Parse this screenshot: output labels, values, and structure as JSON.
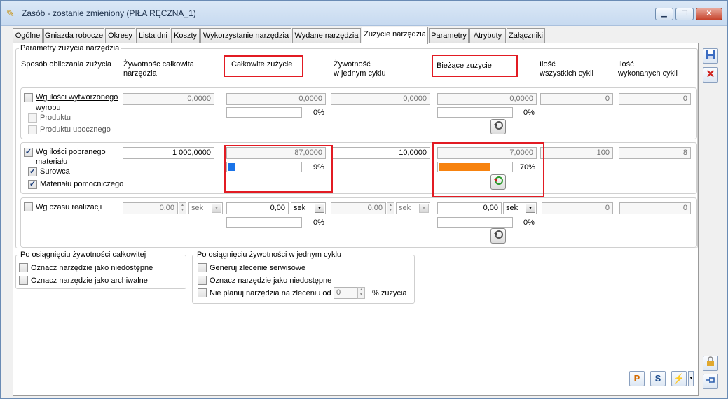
{
  "window": {
    "title": "Zasób - zostanie zmieniony  (PIŁA RĘCZNA_1)",
    "min": "▁",
    "max": "❐",
    "close": "✕"
  },
  "tabs": [
    "Ogólne",
    "Gniazda robocze",
    "Okresy",
    "Lista dni",
    "Koszty",
    "Wykorzystanie narzędzia",
    "Wydane narzędzia",
    "Zużycie narzędzia",
    "Parametry",
    "Atrybuty",
    "Załączniki"
  ],
  "active_tab": "Zużycie narzędzia",
  "params": {
    "group_title": "Parametry zużycia narzędzia",
    "headers": {
      "method": "Sposób obliczania zużycia",
      "total_life_1": "Żywotnośc całkowita",
      "total_life_2": "narzędzia",
      "total_usage": "Całkowite zużycie",
      "cycle_life_1": "Żywotność",
      "cycle_life_2": "w jednym cyklu",
      "current_usage": "Bieżące zużycie",
      "all_cycles_1": "Ilość",
      "all_cycles_2": "wszystkich cykli",
      "done_cycles_1": "Ilość",
      "done_cycles_2": "wykonanych cykli"
    },
    "row1": {
      "label_1": "Wg ilości wytworzonego",
      "label_2": "wyrobu",
      "sub1": "Produktu",
      "sub2": "Produktu ubocznego",
      "total_life": "0,0000",
      "total_usage": "0,0000",
      "total_pct_text": "0%",
      "total_pct": 0,
      "cycle_life": "0,0000",
      "current_usage": "0,0000",
      "current_pct_text": "0%",
      "current_pct": 0,
      "all_cycles": "0",
      "done_cycles": "0"
    },
    "row2": {
      "label_1": "Wg ilości pobranego",
      "label_2": "materiału",
      "sub1": "Surowca",
      "sub2": "Materiału pomocniczego",
      "total_life": "1 000,0000",
      "total_usage": "87,0000",
      "total_pct_text": "9%",
      "total_pct": 9,
      "cycle_life": "10,0000",
      "current_usage": "7,0000",
      "current_pct_text": "70%",
      "current_pct": 70,
      "all_cycles": "100",
      "done_cycles": "8"
    },
    "row3": {
      "label": "Wg czasu realizacji",
      "total_life": "0,00",
      "unit1": "sek",
      "total_usage": "0,00",
      "unit2": "sek",
      "total_pct_text": "0%",
      "total_pct": 0,
      "cycle_life": "0,00",
      "unit3": "sek",
      "current_usage": "0,00",
      "unit4": "sek",
      "current_pct_text": "0%",
      "current_pct": 0,
      "all_cycles": "0",
      "done_cycles": "0"
    }
  },
  "after_total": {
    "title": "Po osiągnięciu żywotności całkowitej",
    "opt1": "Oznacz narzędzie jako niedostępne",
    "opt2": "Oznacz narzędzie jako archiwalne"
  },
  "after_cycle": {
    "title": "Po osiągnięciu żywotności w jednym cyklu",
    "opt1": "Generuj zlecenie serwisowe",
    "opt2": "Oznacz narzędzie jako niedostępne",
    "opt3": "Nie planuj narzędzia na zleceniu od",
    "opt3_value": "0",
    "opt3_suffix": "% zużycia"
  },
  "colors": {
    "accent_red": "#e21b23",
    "bar_blue": "#1a73e8",
    "bar_orange": "#f7830f"
  },
  "bottom_buttons": {
    "p": "P",
    "s": "S"
  }
}
